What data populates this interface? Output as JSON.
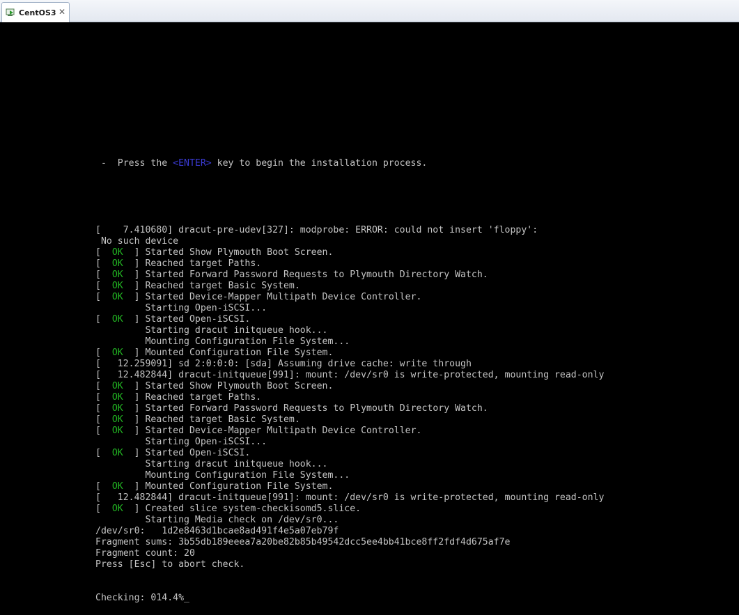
{
  "tab": {
    "title": "CentOS3",
    "close_glyph": "✕",
    "icon": "vm-icon"
  },
  "console": {
    "prompt_prefix": " -  Press the ",
    "prompt_key": "<ENTER>",
    "prompt_suffix": " key to begin the installation process.",
    "lines": [
      {
        "type": "raw",
        "text": "[    7.410680] dracut-pre-udev[327]: modprobe: ERROR: could not insert 'floppy':"
      },
      {
        "type": "raw",
        "text": " No such device"
      },
      {
        "type": "ok",
        "prefix": "[  ",
        "status": "OK",
        "suffix": "  ] Started Show Plymouth Boot Screen."
      },
      {
        "type": "ok",
        "prefix": "[  ",
        "status": "OK",
        "suffix": "  ] Reached target Paths."
      },
      {
        "type": "ok",
        "prefix": "[  ",
        "status": "OK",
        "suffix": "  ] Started Forward Password Requests to Plymouth Directory Watch."
      },
      {
        "type": "ok",
        "prefix": "[  ",
        "status": "OK",
        "suffix": "  ] Reached target Basic System."
      },
      {
        "type": "ok",
        "prefix": "[  ",
        "status": "OK",
        "suffix": "  ] Started Device-Mapper Multipath Device Controller."
      },
      {
        "type": "raw",
        "text": "         Starting Open-iSCSI..."
      },
      {
        "type": "ok",
        "prefix": "[  ",
        "status": "OK",
        "suffix": "  ] Started Open-iSCSI."
      },
      {
        "type": "raw",
        "text": "         Starting dracut initqueue hook..."
      },
      {
        "type": "raw",
        "text": "         Mounting Configuration File System..."
      },
      {
        "type": "ok",
        "prefix": "[  ",
        "status": "OK",
        "suffix": "  ] Mounted Configuration File System."
      },
      {
        "type": "raw",
        "text": "[   12.259091] sd 2:0:0:0: [sda] Assuming drive cache: write through"
      },
      {
        "type": "raw",
        "text": "[   12.482844] dracut-initqueue[991]: mount: /dev/sr0 is write-protected, mounting read-only"
      },
      {
        "type": "ok",
        "prefix": "[  ",
        "status": "OK",
        "suffix": "  ] Started Show Plymouth Boot Screen."
      },
      {
        "type": "ok",
        "prefix": "[  ",
        "status": "OK",
        "suffix": "  ] Reached target Paths."
      },
      {
        "type": "ok",
        "prefix": "[  ",
        "status": "OK",
        "suffix": "  ] Started Forward Password Requests to Plymouth Directory Watch."
      },
      {
        "type": "ok",
        "prefix": "[  ",
        "status": "OK",
        "suffix": "  ] Reached target Basic System."
      },
      {
        "type": "ok",
        "prefix": "[  ",
        "status": "OK",
        "suffix": "  ] Started Device-Mapper Multipath Device Controller."
      },
      {
        "type": "raw",
        "text": "         Starting Open-iSCSI..."
      },
      {
        "type": "ok",
        "prefix": "[  ",
        "status": "OK",
        "suffix": "  ] Started Open-iSCSI."
      },
      {
        "type": "raw",
        "text": "         Starting dracut initqueue hook..."
      },
      {
        "type": "raw",
        "text": "         Mounting Configuration File System..."
      },
      {
        "type": "ok",
        "prefix": "[  ",
        "status": "OK",
        "suffix": "  ] Mounted Configuration File System."
      },
      {
        "type": "raw",
        "text": "[   12.482844] dracut-initqueue[991]: mount: /dev/sr0 is write-protected, mounting read-only"
      },
      {
        "type": "ok",
        "prefix": "[  ",
        "status": "OK",
        "suffix": "  ] Created slice system-checkisomd5.slice."
      },
      {
        "type": "raw",
        "text": "         Starting Media check on /dev/sr0..."
      },
      {
        "type": "raw",
        "text": "/dev/sr0:   1d2e8463d1bcae8ad491f4e5a07eb79f"
      },
      {
        "type": "raw",
        "text": "Fragment sums: 3b55db189eeea7a20be82b85b49542dcc5ee4bb41bce8ff2fdf4d675af7e"
      },
      {
        "type": "raw",
        "text": "Fragment count: 20"
      },
      {
        "type": "raw",
        "text": "Press [Esc] to abort check."
      }
    ],
    "checking_label": "Checking: 014.4%",
    "cursor": "_"
  },
  "colors": {
    "background": "#000000",
    "text": "#c4c4c4",
    "ok": "#22b322",
    "enter_key": "#3b3bd6"
  }
}
